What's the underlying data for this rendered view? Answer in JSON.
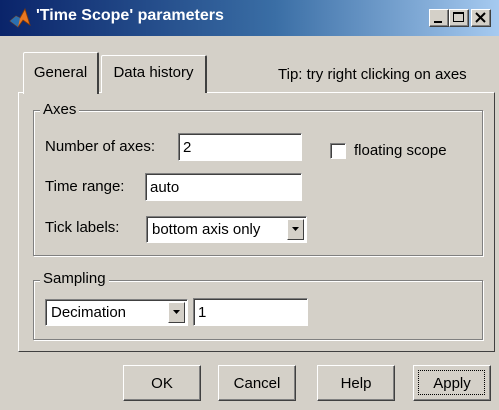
{
  "window": {
    "title": "'Time Scope' parameters"
  },
  "tabs": [
    {
      "label": "General",
      "selected": true
    },
    {
      "label": "Data history",
      "selected": false
    }
  ],
  "tip": "Tip: try right clicking on axes",
  "axes_group": {
    "title": "Axes",
    "number_of_axes_label": "Number of axes:",
    "number_of_axes_value": "2",
    "floating_scope_label": "floating scope",
    "floating_scope_checked": false,
    "time_range_label": "Time range:",
    "time_range_value": "auto",
    "tick_labels_label": "Tick labels:",
    "tick_labels_value": "bottom axis only"
  },
  "sampling_group": {
    "title": "Sampling",
    "mode_value": "Decimation",
    "factor_value": "1"
  },
  "buttons": {
    "ok": "OK",
    "cancel": "Cancel",
    "help": "Help",
    "apply": "Apply"
  },
  "icons": {
    "app": "matlab-icon",
    "minimize": "minimize-icon",
    "maximize": "maximize-icon",
    "close": "close-icon",
    "dropdown": "chevron-down-icon"
  },
  "colors": {
    "titlebar_start": "#0a246a",
    "titlebar_end": "#a6caf0",
    "face": "#d4d0c8"
  }
}
